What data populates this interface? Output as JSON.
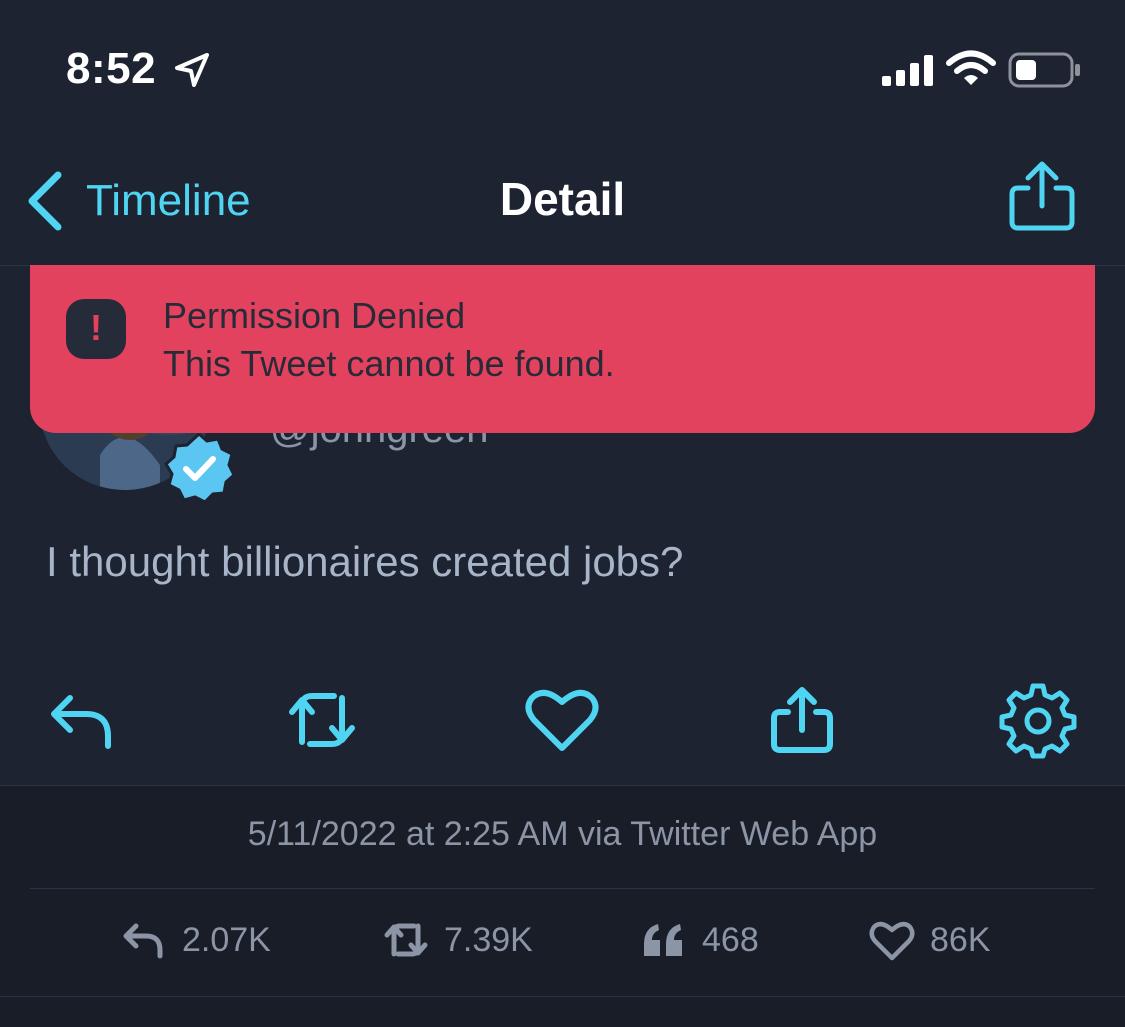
{
  "status_bar": {
    "time": "8:52"
  },
  "nav": {
    "back_label": "Timeline",
    "title": "Detail"
  },
  "toast": {
    "title": "Permission Denied",
    "message": "This Tweet cannot be found."
  },
  "tweet": {
    "handle": "@johngreen",
    "text": "I thought billionaires created jobs?",
    "timestamp": "5/11/2022 at 2:25 AM via Twitter Web App"
  },
  "stats": {
    "replies": "2.07K",
    "retweets": "7.39K",
    "quotes": "468",
    "likes": "86K"
  },
  "colors": {
    "accent": "#4fd4f2",
    "toast_bg": "#e3425e",
    "background": "#1d2330",
    "muted": "#8b95a6"
  },
  "icons": {
    "location": "location-arrow-icon",
    "signal": "cellular-signal-icon",
    "wifi": "wifi-icon",
    "battery": "battery-icon",
    "back": "chevron-left-icon",
    "share": "share-icon",
    "verified": "verified-badge-icon",
    "reply": "reply-icon",
    "retweet": "retweet-icon",
    "like": "heart-icon",
    "settings": "gear-icon",
    "quote": "quote-icon"
  }
}
